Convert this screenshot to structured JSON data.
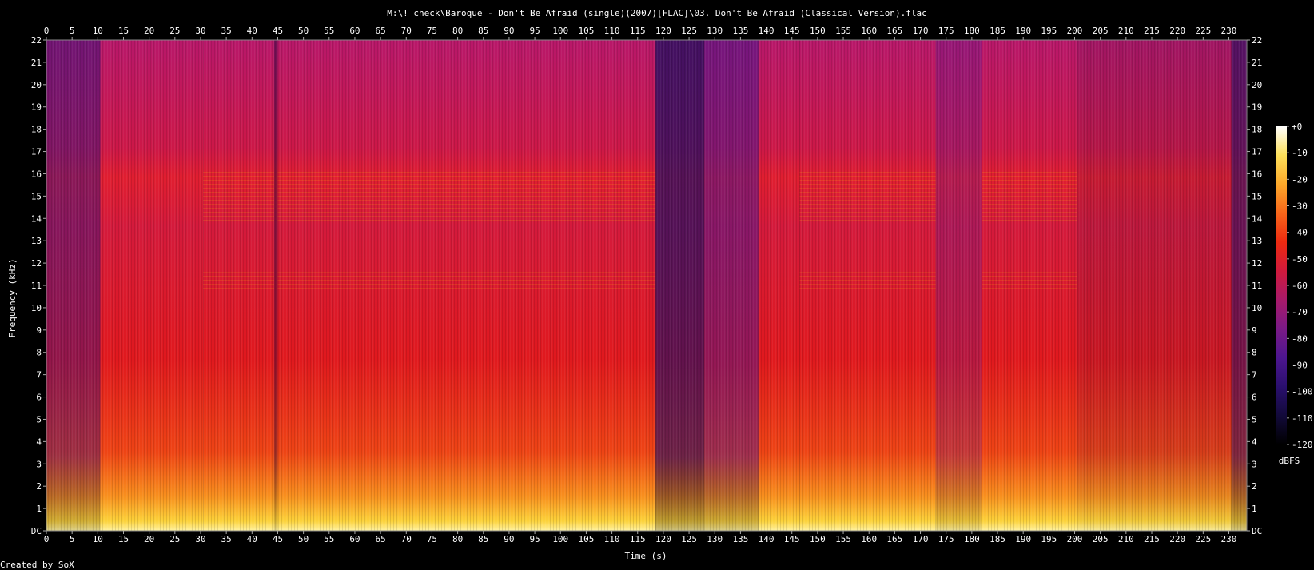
{
  "chart_data": {
    "type": "heatmap",
    "title": "M:\\! check\\Baroque - Don't Be Afraid (single)(2007)[FLAC]\\03. Don't Be Afraid (Classical Version).flac",
    "xlabel": "Time (s)",
    "ylabel": "Frequency (kHz)",
    "xlim": [
      0,
      233.5
    ],
    "ylim": [
      0,
      22
    ],
    "x_ticks": [
      "0",
      "5",
      "10",
      "15",
      "20",
      "25",
      "30",
      "35",
      "40",
      "45",
      "50",
      "55",
      "60",
      "65",
      "70",
      "75",
      "80",
      "85",
      "90",
      "95",
      "100",
      "105",
      "110",
      "115",
      "120",
      "125",
      "130",
      "135",
      "140",
      "145",
      "150",
      "155",
      "160",
      "165",
      "170",
      "175",
      "180",
      "185",
      "190",
      "195",
      "200",
      "205",
      "210",
      "215",
      "220",
      "225",
      "230"
    ],
    "y_ticks": [
      "DC",
      "1",
      "2",
      "3",
      "4",
      "5",
      "6",
      "7",
      "8",
      "9",
      "10",
      "11",
      "12",
      "13",
      "14",
      "15",
      "16",
      "17",
      "18",
      "19",
      "20",
      "21",
      "22"
    ],
    "colorbar": {
      "label": "dBFS",
      "ticks": [
        "+0",
        "-10",
        "-20",
        "-30",
        "-40",
        "-50",
        "-60",
        "-70",
        "-80",
        "-90",
        "-100",
        "-110",
        "-120"
      ],
      "range": [
        -120,
        0
      ],
      "colors": [
        "#000000",
        "#120a3a",
        "#2a0f6e",
        "#4d1690",
        "#7a1a86",
        "#a81a6a",
        "#d01a3c",
        "#ec2a10",
        "#f8661a",
        "#fca82a",
        "#fde05a",
        "#ffffff"
      ]
    },
    "segments": [
      {
        "start": 0,
        "end": 10.5,
        "level": "quiet-intro"
      },
      {
        "start": 10.5,
        "end": 30.5,
        "level": "loud"
      },
      {
        "start": 30.5,
        "end": 44.3,
        "level": "loud-16k"
      },
      {
        "start": 44.3,
        "end": 45.0,
        "level": "gap"
      },
      {
        "start": 45.0,
        "end": 118.5,
        "level": "loud-16k"
      },
      {
        "start": 118.5,
        "end": 128.0,
        "level": "quiet-dark"
      },
      {
        "start": 128.0,
        "end": 138.5,
        "level": "quiet"
      },
      {
        "start": 138.5,
        "end": 146.5,
        "level": "loud"
      },
      {
        "start": 146.5,
        "end": 173.0,
        "level": "loud-16k"
      },
      {
        "start": 173.0,
        "end": 182.0,
        "level": "mid-dark"
      },
      {
        "start": 182.0,
        "end": 200.5,
        "level": "loud-16k"
      },
      {
        "start": 200.5,
        "end": 230.5,
        "level": "fading"
      },
      {
        "start": 230.5,
        "end": 233.5,
        "level": "tail"
      }
    ],
    "footer": "Created by SoX"
  }
}
